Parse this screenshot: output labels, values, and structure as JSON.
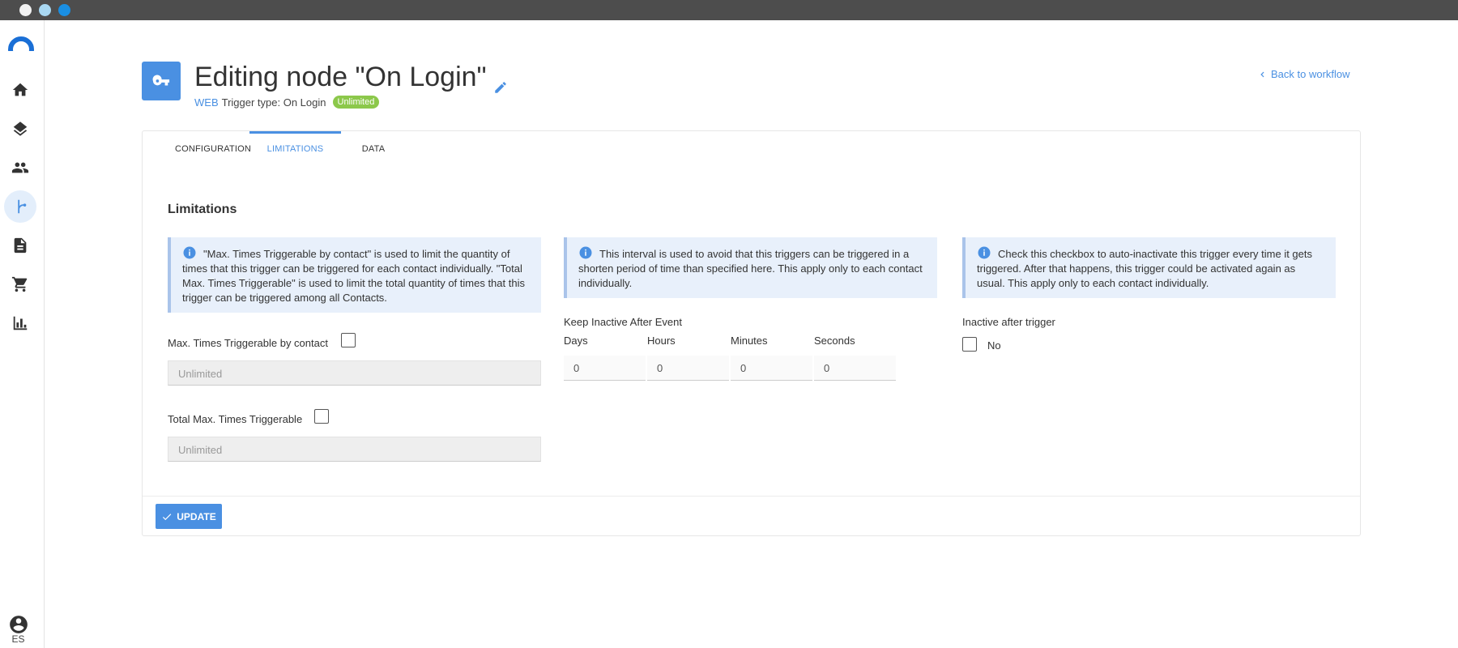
{
  "page": {
    "title": "Editing node \"On Login\"",
    "subtitle_web": "WEB",
    "subtitle_trigger": "Trigger type: On Login",
    "badge": "Unlimited",
    "back_link": "Back to workflow"
  },
  "sidebar": {
    "items": [
      {
        "icon": "home-icon"
      },
      {
        "icon": "layers-icon"
      },
      {
        "icon": "people-icon"
      },
      {
        "icon": "workflow-icon",
        "active": true
      },
      {
        "icon": "document-icon"
      },
      {
        "icon": "cart-icon"
      },
      {
        "icon": "chart-icon"
      }
    ],
    "language": "ES"
  },
  "tabs": {
    "configuration": "CONFIGURATION",
    "limitations": "LIMITATIONS",
    "data": "DATA"
  },
  "limitations": {
    "title": "Limitations",
    "info1": "\"Max. Times Triggerable by contact\" is used to limit the quantity of times that this trigger can be triggered for each contact individually. \"Total Max. Times Triggerable\" is used to limit the total quantity of times that this trigger can be triggered among all Contacts.",
    "info2": "This interval is used to avoid that this triggers can be triggered in a shorten period of time than specified here. This apply only to each contact individually.",
    "info3": "Check this checkbox to auto-inactivate this trigger every time it gets triggered. After that happens, this trigger could be activated again as usual. This apply only to each contact individually.",
    "max_by_contact_label": "Max. Times Triggerable by contact",
    "max_by_contact_placeholder": "Unlimited",
    "total_max_label": "Total Max. Times Triggerable",
    "total_max_placeholder": "Unlimited",
    "keep_inactive_label": "Keep Inactive After Event",
    "days_label": "Days",
    "hours_label": "Hours",
    "minutes_label": "Minutes",
    "seconds_label": "Seconds",
    "days_value": "0",
    "hours_value": "0",
    "minutes_value": "0",
    "seconds_value": "0",
    "inactive_label": "Inactive after trigger",
    "inactive_value": "No"
  },
  "footer": {
    "update_label": "UPDATE"
  },
  "colors": {
    "accent": "#4a90e2",
    "badge": "#8cc84b",
    "info_bg": "#e8f0fb"
  }
}
